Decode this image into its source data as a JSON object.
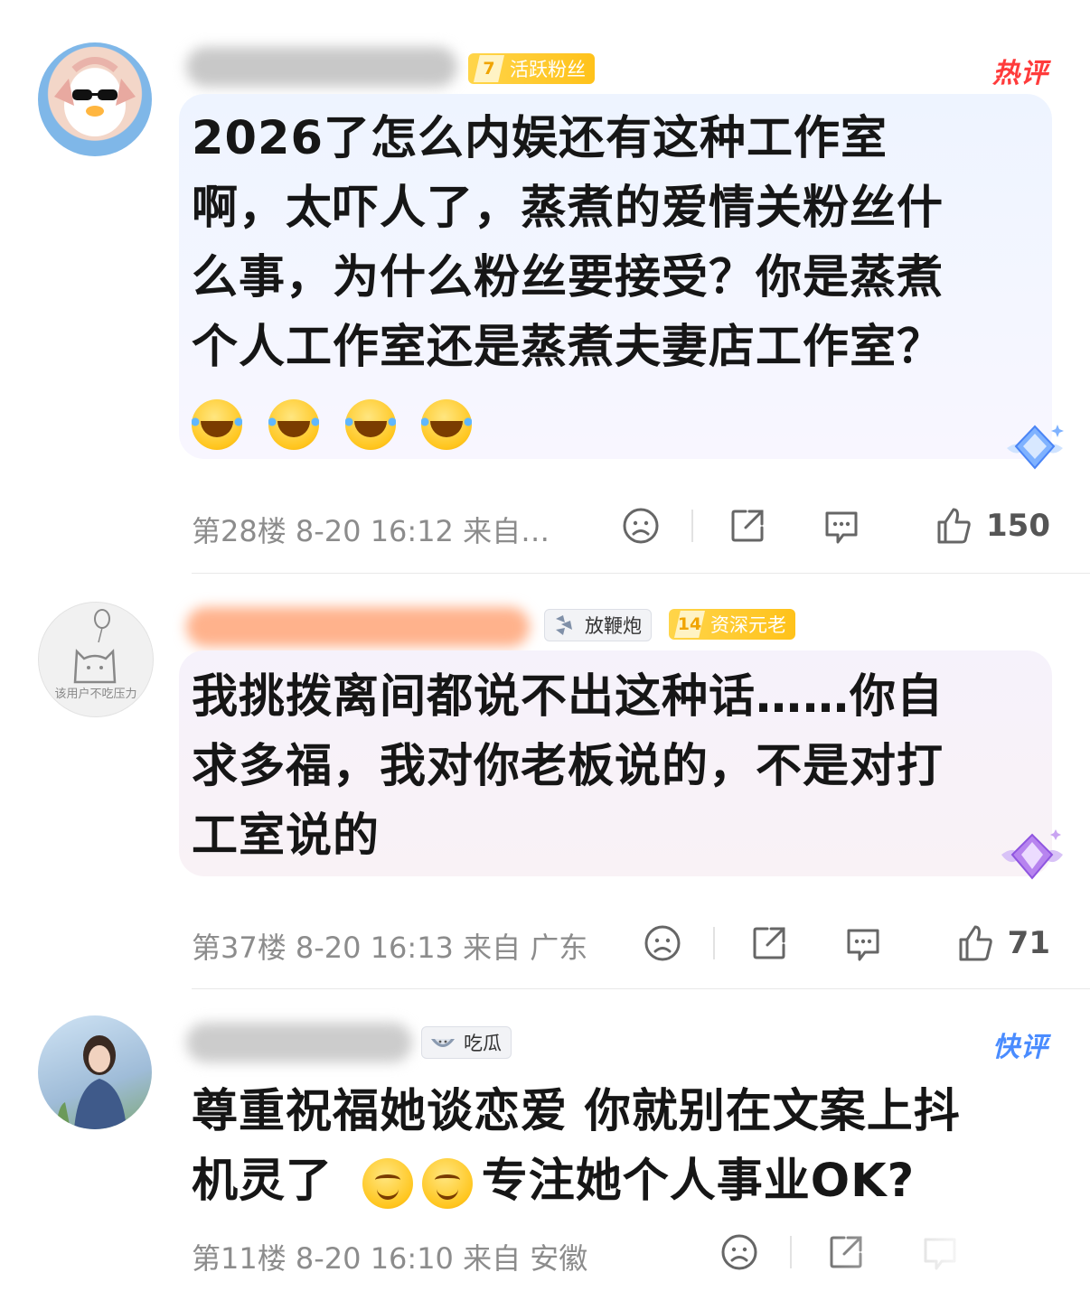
{
  "comments": [
    {
      "fan_badge": {
        "level": "7",
        "label": "活跃粉丝"
      },
      "tag": "热评",
      "text_lines": [
        "2026了怎么内娱还有这种工作室",
        "啊，太吓人了，蒸煮的爱情关粉丝什",
        "么事，为什么粉丝要接受？你是蒸煮",
        "个人工作室还是蒸煮夫妻店工作室？"
      ],
      "meta": "第28楼 8-20 16:12 来自…",
      "likes": "150"
    },
    {
      "avatar_caption": "该用户不吃压力",
      "medal_badge": "放鞭炮",
      "fan_badge": {
        "level": "14",
        "label": "资深元老"
      },
      "text_lines": [
        "我挑拨离间都说不出这种话……你自",
        "求多福，我对你老板说的，不是对打",
        "工室说的"
      ],
      "meta": "第37楼 8-20 16:13 来自 广东",
      "likes": "71"
    },
    {
      "medal_badge": "吃瓜",
      "tag": "快评",
      "text_lines": [
        "尊重祝福她谈恋爱 你就别在文案上抖"
      ],
      "text_line2_pre": "机灵了",
      "text_line2_post": "专注她个人事业OK?",
      "meta": "第11楼 8-20 16:10 来自 安徽"
    }
  ],
  "icons": [
    "dislike-face-icon",
    "share-icon",
    "comment-icon",
    "thumbs-up-icon",
    "diamond-icon",
    "laugh-emoji",
    "smile-emoji"
  ],
  "colors": {
    "hot": "#ff3b3b",
    "fast": "#4a8cff",
    "fan_badge": "#ffc21a",
    "meta_gray": "#8c8c8c"
  }
}
